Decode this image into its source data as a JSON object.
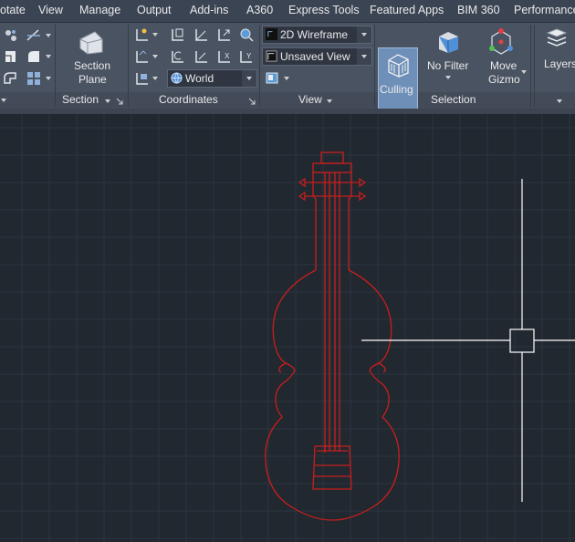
{
  "menu": [
    "otate",
    "View",
    "Manage",
    "Output",
    "Add-ins",
    "A360",
    "Express Tools",
    "Featured Apps",
    "BIM 360",
    "Performance"
  ],
  "ribbon": {
    "section_plane_line1": "Section",
    "section_plane_line2": "Plane",
    "panel_section": "Section",
    "panel_coordinates": "Coordinates",
    "ucs_combo": "World",
    "visual_style": "2D Wireframe",
    "named_view": "Unsaved View",
    "panel_view": "View",
    "culling": "Culling",
    "no_filter": "No Filter",
    "move_gizmo_line1": "Move",
    "move_gizmo_line2": "Gizmo",
    "panel_selection": "Selection",
    "layers": "Layers"
  },
  "colors": {
    "drawing": "#c81e1e",
    "canvas": "#212830",
    "grid": "#2c343f",
    "crosshair": "#ffffff"
  }
}
